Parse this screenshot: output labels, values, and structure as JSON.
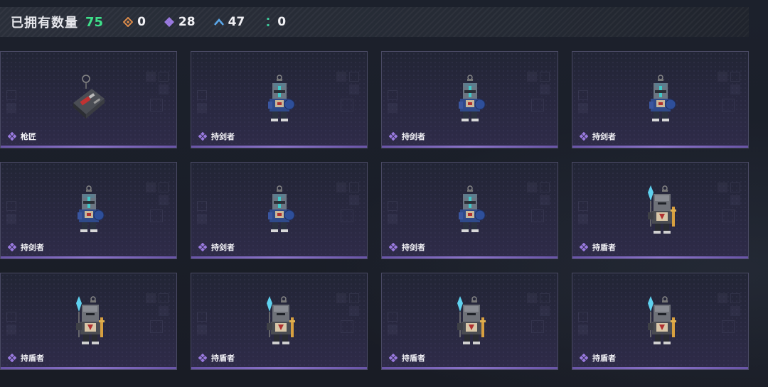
{
  "header": {
    "owned_label": "已拥有数量",
    "owned_count": "75",
    "stats": [
      {
        "icon": "orange-diamond-icon",
        "color": "#d98a4a",
        "value": "0"
      },
      {
        "icon": "purple-diamond-icon",
        "color": "#9a7ae0",
        "value": "28"
      },
      {
        "icon": "blue-chevron-icon",
        "color": "#5aa6e8",
        "value": "47"
      },
      {
        "icon": "green-dots-icon",
        "color": "#3ec89a",
        "value": "0"
      }
    ]
  },
  "cards": [
    {
      "name": "枪匠",
      "figure": "box"
    },
    {
      "name": "持剑者",
      "figure": "sword"
    },
    {
      "name": "持剑者",
      "figure": "sword"
    },
    {
      "name": "持剑者",
      "figure": "sword"
    },
    {
      "name": "持剑者",
      "figure": "sword"
    },
    {
      "name": "持剑者",
      "figure": "sword"
    },
    {
      "name": "持剑者",
      "figure": "sword"
    },
    {
      "name": "持盾者",
      "figure": "shield"
    },
    {
      "name": "持盾者",
      "figure": "shield"
    },
    {
      "name": "持盾者",
      "figure": "shield"
    },
    {
      "name": "持盾者",
      "figure": "shield"
    },
    {
      "name": "持盾者",
      "figure": "shield"
    }
  ],
  "colors": {
    "accent_green": "#3ee08a",
    "rarity_purple": "#8a73c8"
  }
}
